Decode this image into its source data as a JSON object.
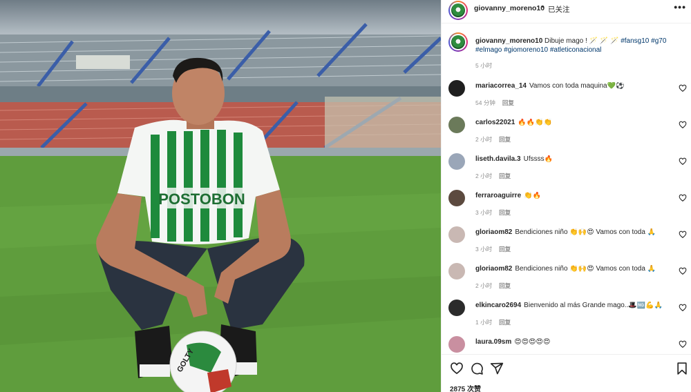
{
  "post": {
    "username": "giovanny_moreno10",
    "separator": "•",
    "follow_status": "已关注",
    "more_label": "•••",
    "caption": {
      "username": "giovanny_moreno10",
      "text": "Dibuje mago ! 🪄 🪄 🪄",
      "tags": [
        "#fansg10",
        "#g70",
        "#elmago",
        "#giomoreno10",
        "#atleticonacional"
      ],
      "time": "5 小时"
    },
    "likes": "2875 次赞"
  },
  "comments": [
    {
      "user": "mariacorrea_14",
      "text": "Vamos con toda maquina💚⚽",
      "time": "54 分钟",
      "reply": "回复",
      "avatar_color": "#1f1f1f"
    },
    {
      "user": "carlos22021",
      "text": "🔥🔥👏👏",
      "time": "2 小时",
      "reply": "回复",
      "avatar_color": "#6b7a5a"
    },
    {
      "user": "liseth.davila.3",
      "text": "Ufssss🔥",
      "time": "2 小时",
      "reply": "回复",
      "avatar_color": "#9aa6b8"
    },
    {
      "user": "ferraroaguirre",
      "text": "👏🔥",
      "time": "3 小时",
      "reply": "回复",
      "avatar_color": "#5c4a3f"
    },
    {
      "user": "gloriaom82",
      "text": "Bendiciones niño 👏🙌😍 Vamos con toda 🙏",
      "time": "3 小时",
      "reply": "回复",
      "avatar_color": "#c9b8b3"
    },
    {
      "user": "gloriaom82",
      "text": "Bendiciones niño 👏🙌😍 Vamos con toda 🙏",
      "time": "2 小时",
      "reply": "回复",
      "avatar_color": "#c9b8b3"
    },
    {
      "user": "elkincaro2694",
      "text": "Bienvenido al más Grande mago..🎩🆖💪🙏",
      "time": "1 小时",
      "reply": "回复",
      "avatar_color": "#2b2b2b"
    },
    {
      "user": "laura.09sm",
      "text": "😍😍😍😍😍",
      "time": "",
      "reply": "",
      "avatar_color": "#c98fa0"
    }
  ],
  "photo": {
    "jersey_sponsor": "POSTOBON",
    "ball_brand": "GOLTY"
  },
  "icons": {
    "like": "heart-icon",
    "comment": "comment-icon",
    "share": "share-icon",
    "save": "bookmark-icon"
  },
  "colors": {
    "text": "#262626",
    "muted": "#8e8e8e",
    "hashtag": "#00376b",
    "jersey_green": "#1e8a3c"
  }
}
